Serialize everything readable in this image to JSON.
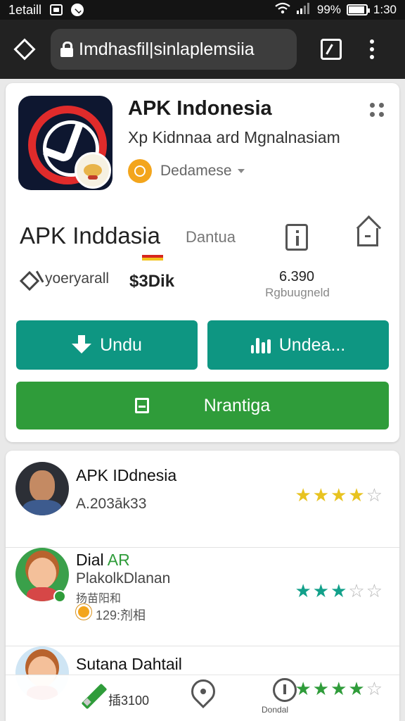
{
  "colors": {
    "teal": "#0e9682",
    "green": "#2f9c3a",
    "star_yellow": "#e8c320",
    "star_teal": "#12a08a",
    "star_green": "#2f9c3a",
    "star_empty": "#b5b5b5"
  },
  "status_bar": {
    "carrier": "1etaill",
    "battery": "99%",
    "time": "1:30"
  },
  "browser": {
    "url": "Imdhasfil|sinlaplemsiia"
  },
  "app": {
    "title": "APK Indonesia",
    "subtitle": "Xp Kidnnaa ard Mgnalnasiam",
    "developer": "Dedamese",
    "name_large": "APK Inddasia",
    "name_large_sub": "Dantua",
    "category": "yoeryarall",
    "price": "$3Dik",
    "stat_value": "6.390",
    "stat_label": "Rgbuugneld"
  },
  "buttons": {
    "download": "Undu",
    "update": "Undea...",
    "install": "Nrantiga"
  },
  "reviews": [
    {
      "name": "APK IDdnesia",
      "line": "A.203āk33",
      "rating": 4,
      "star_color": "yellow"
    },
    {
      "name_prefix": "Dial",
      "name_accent": "AR",
      "line": "PlakolkDlanan",
      "small": "扬苗阳和",
      "date": "129:剂相",
      "rating": 3,
      "star_color": "teal"
    },
    {
      "name": "Sutana Dahtail",
      "rating": 4,
      "star_color": "green"
    }
  ],
  "bottom_nav": {
    "left_label": "插3100",
    "right_label": "Dondal"
  }
}
